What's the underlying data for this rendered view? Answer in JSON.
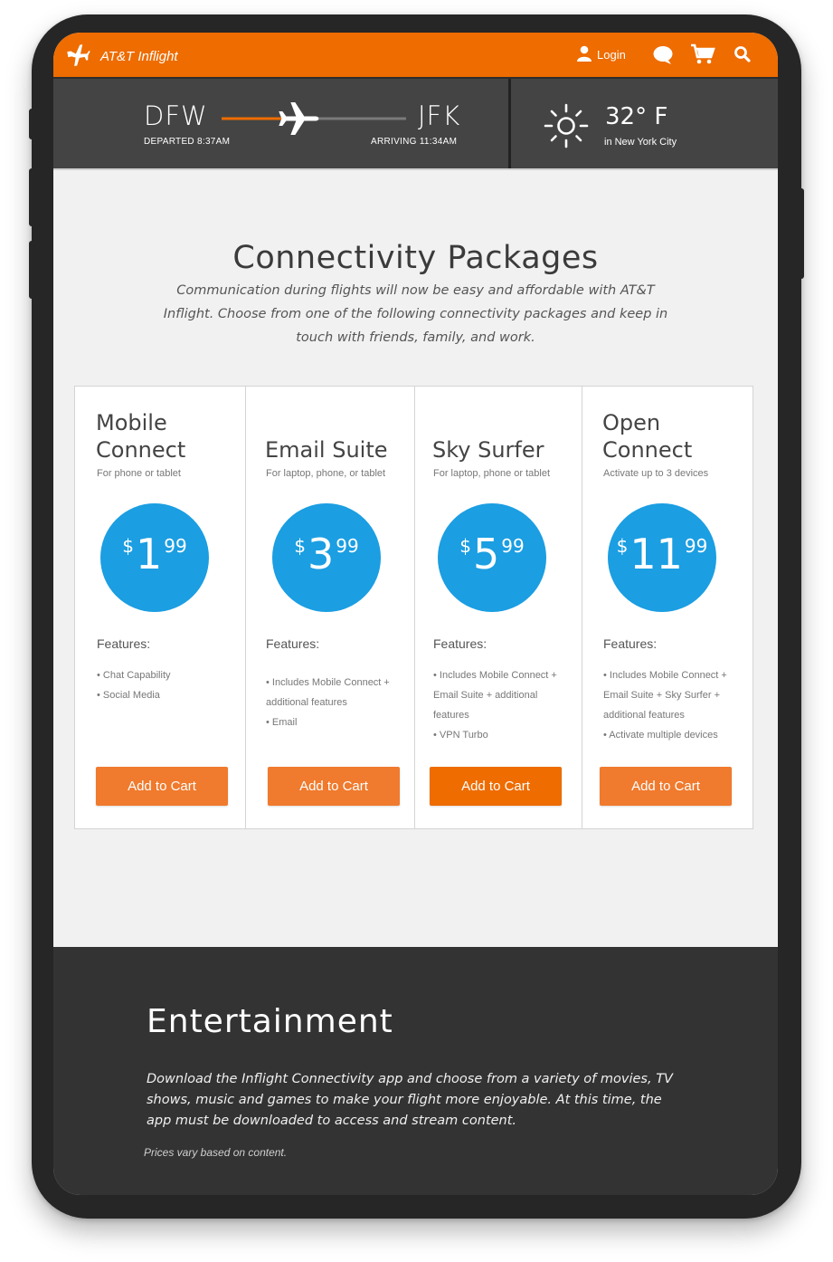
{
  "app": {
    "brand": "AT&T Inflight",
    "brand_color": "#ee6c00"
  },
  "nav": {
    "login_label": "Login",
    "icons": [
      "person-icon",
      "chat-icon",
      "cart-icon",
      "search-icon"
    ]
  },
  "flight": {
    "origin": "DFW",
    "departed": "DEPARTED 8:37AM",
    "destination": "JFK",
    "arriving": "ARRIVING 11:34AM",
    "progress": 0.33,
    "temperature": "32° F",
    "city": "in New York City",
    "weather_icon": "sun-icon"
  },
  "packages": {
    "title": "Connectivity Packages",
    "description": "Communication during flights will now be easy and affordable with AT&T Inflight. Choose from one of the following connectivity packages and keep in touch with friends, family, and work.",
    "features_heading": "Features:",
    "button_label": "Add to Cart",
    "price_color": "#1b9ee2",
    "items": [
      {
        "name_line1": "Mobile",
        "name_line2": "Connect",
        "tagline": "For phone or tablet",
        "currency": "$",
        "price_dollars": "1",
        "price_cents": "99",
        "features": [
          "• Chat Capability",
          "• Social Media"
        ]
      },
      {
        "name_line1": "",
        "name_line2": "Email Suite",
        "tagline": "For laptop, phone, or tablet",
        "currency": "$",
        "price_dollars": "3",
        "price_cents": "99",
        "features": [
          "• Includes Mobile Connect +",
          "additional features",
          "• Email"
        ]
      },
      {
        "name_line1": "",
        "name_line2": "Sky Surfer",
        "tagline": "For laptop, phone or tablet",
        "currency": "$",
        "price_dollars": "5",
        "price_cents": "99",
        "features": [
          "• Includes Mobile Connect +",
          "Email Suite + additional",
          "features",
          "• VPN Turbo"
        ]
      },
      {
        "name_line1": "Open",
        "name_line2": "Connect",
        "tagline": "Activate up to 3 devices",
        "currency": "$",
        "price_dollars": "11",
        "price_cents": "99",
        "features": [
          "• Includes Mobile Connect +",
          "Email Suite + Sky Surfer +",
          "additional features",
          "• Activate multiple devices"
        ]
      }
    ]
  },
  "entertainment": {
    "title": "Entertainment",
    "description": "Download the Inflight Connectivity app and choose from a variety of movies, TV shows, music and games to make your flight more enjoyable. At this time, the app must be downloaded to access and stream content.",
    "note": "Prices vary based on content."
  }
}
